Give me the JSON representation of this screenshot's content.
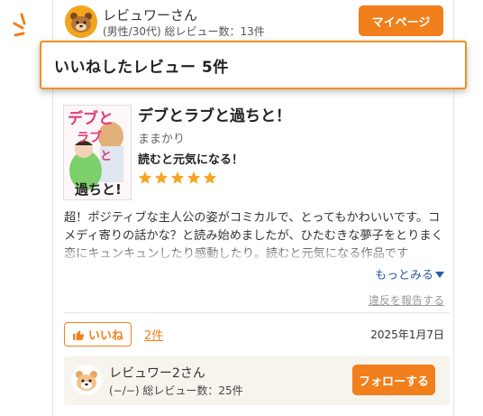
{
  "top_user": {
    "name": "レビュワーさん",
    "meta": "(男性/30代) 総レビュー数：13件",
    "mypage_button": "マイページ"
  },
  "banner": {
    "title": "いいねしたレビュー 5件"
  },
  "book": {
    "title": "デブとラブと過ちと！",
    "author": "ままかり",
    "headline": "読むと元気になる！",
    "rating": 5,
    "cover_text": "デブとラブと過ちと!"
  },
  "review": {
    "body": "超！ポジティブな主人公の姿がコミカルで、とってもかわいいです。コメディ寄りの話かな？と読み始めましたが、ひたむきな夢子をとりまく恋にキュンキュンしたり感動したり。読むと元気になる作品です",
    "more_label": "もっとみる",
    "report_label": "違反を報告する",
    "like_label": "いいね",
    "like_count": "2件",
    "date": "2025年1月7日"
  },
  "reviewer": {
    "name": "レビュワー2さん",
    "meta": "(−/−) 総レビュー数：25件",
    "follow_button": "フォローする"
  },
  "colors": {
    "accent": "#f07f1c",
    "link": "#2a5ba8",
    "star": "#f5a623"
  }
}
